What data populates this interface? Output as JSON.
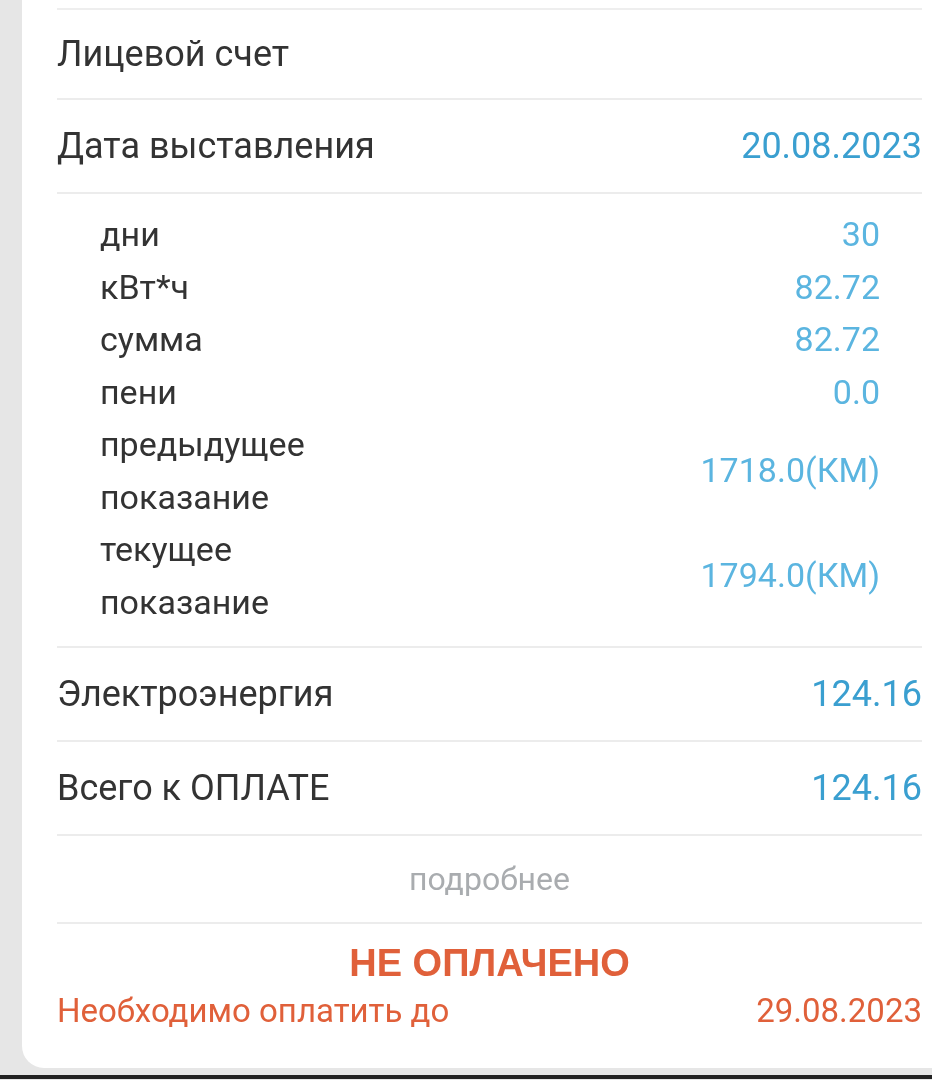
{
  "account": {
    "label": "Лицевой счет"
  },
  "issue_date": {
    "label": "Дата выставления",
    "value": "20.08.2023"
  },
  "details": [
    {
      "label": "дни",
      "value": "30"
    },
    {
      "label": "кВт*ч",
      "value": "82.72"
    },
    {
      "label": "сумма",
      "value": "82.72"
    },
    {
      "label": "пени",
      "value": "0.0"
    },
    {
      "label": "предыдущее показание",
      "value": "1718.0(КМ)"
    },
    {
      "label": "текущее показание",
      "value": "1794.0(КМ)"
    }
  ],
  "charges": [
    {
      "label": "Электроэнергия",
      "value": "124.16"
    },
    {
      "label": "Всего к ОПЛАТЕ",
      "value": "124.16"
    }
  ],
  "more_link": "подробнее",
  "status": {
    "title": "НЕ ОПЛАЧЕНО",
    "due_label": "Необходимо оплатить до",
    "due_date": "29.08.2023"
  }
}
